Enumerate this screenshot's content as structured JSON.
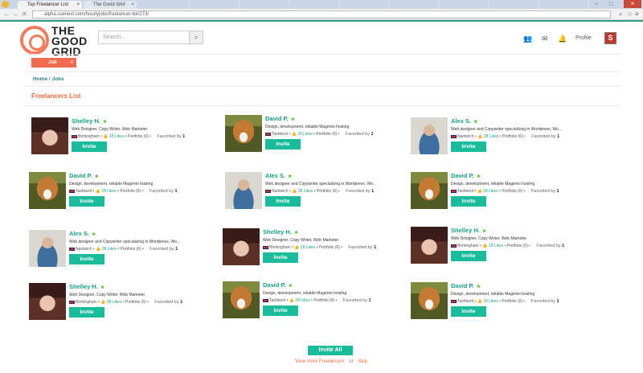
{
  "browser": {
    "active_tab_title": "Top Freelancer List",
    "second_tab_title": "The Good Grid",
    "url": "alpha.csenext.com/hourlyjobs/freelancer-list/273/"
  },
  "header": {
    "logo_text_top": "THE GOOD",
    "logo_text_bottom": "GRID",
    "search_placeholder": "Search...",
    "profile_label": "Profile",
    "avatar_letter": "S"
  },
  "nav": {
    "job_button": "Job",
    "breadcrumb": "Home / Jobs"
  },
  "section_title": "Freelancers List",
  "cards": [
    {
      "name": "Shelley H.",
      "title": "Web Designer, Copy Writer, Web Marketer",
      "location": "Birmingham",
      "likes": "28 Likes",
      "portfolio": "Portfolio (6)",
      "favorited_prefix": "Favorited by",
      "favorited_count": "1",
      "invite": "Invite",
      "photo": "woman"
    },
    {
      "name": "David P.",
      "title": "Design, development, reliable Magento hosting",
      "location": "Tashkent",
      "likes": "28 Likes",
      "portfolio": "Portfolio (6)",
      "favorited_prefix": "Favorited by",
      "favorited_count": "1",
      "invite": "Invite",
      "photo": "dog"
    },
    {
      "name": "Alex S.",
      "title": "Web designer and Copywriter specializing in Wordpress, Wo...",
      "location": "Nantwich",
      "likes": "28 Likes",
      "portfolio": "Portfolio (6)",
      "favorited_prefix": "Favorited by",
      "favorited_count": "1",
      "invite": "Invite",
      "photo": "man"
    },
    {
      "name": "David P.",
      "title": "Design, development, reliable Magento hosting",
      "location": "Tashkent",
      "likes": "28 Likes",
      "portfolio": "Portfolio (6)",
      "favorited_prefix": "Favorited by",
      "favorited_count": "1",
      "invite": "Invite",
      "photo": "dog"
    },
    {
      "name": "Alex S.",
      "title": "Web designer and Copywriter specializing in Wordpress, Wo...",
      "location": "Nantwich",
      "likes": "28 Likes",
      "portfolio": "Portfolio (6)",
      "favorited_prefix": "Favorited by",
      "favorited_count": "1",
      "invite": "Invite",
      "photo": "man"
    },
    {
      "name": "David P.",
      "title": "Design, development, reliable Magento hosting",
      "location": "Tashkent",
      "likes": "28 Likes",
      "portfolio": "Portfolio (6)",
      "favorited_prefix": "Favorited by",
      "favorited_count": "1",
      "invite": "Invite",
      "photo": "dog"
    },
    {
      "name": "Alex S.",
      "title": "Web designer and Copywriter specializing in Wordpress, Wo...",
      "location": "Nantwich",
      "likes": "28 Likes",
      "portfolio": "Portfolio (6)",
      "favorited_prefix": "Favorited by",
      "favorited_count": "1",
      "invite": "Invite",
      "photo": "man"
    },
    {
      "name": "Shelley H.",
      "title": "Web Designer, Copy Writer, Web Marketer",
      "location": "Birmingham",
      "likes": "28 Likes",
      "portfolio": "Portfolio (6)",
      "favorited_prefix": "Favorited by",
      "favorited_count": "1",
      "invite": "Invite",
      "photo": "woman"
    },
    {
      "name": "Shelley H.",
      "title": "Web Designer, Copy Writer, Web Marketer",
      "location": "Birmingham",
      "likes": "28 Likes",
      "portfolio": "Portfolio (6)",
      "favorited_prefix": "Favorited by",
      "favorited_count": "1",
      "invite": "Invite",
      "photo": "woman"
    },
    {
      "name": "Shelley H.",
      "title": "Web Designer, Copy Writer, Web Marketer",
      "location": "Birmingham",
      "likes": "28 Likes",
      "portfolio": "Portfolio (6)",
      "favorited_prefix": "Favorited by",
      "favorited_count": "1",
      "invite": "Invite",
      "photo": "woman"
    },
    {
      "name": "David P.",
      "title": "Design, development, reliable Magento hosting",
      "location": "Tashkent",
      "likes": "28 Likes",
      "portfolio": "Portfolio (6)",
      "favorited_prefix": "Favorited by",
      "favorited_count": "1",
      "invite": "Invite",
      "photo": "dog"
    },
    {
      "name": "David P.",
      "title": "Design, development, reliable Magento hosting",
      "location": "Tashkent",
      "likes": "28 Likes",
      "portfolio": "Portfolio (6)",
      "favorited_prefix": "Favorited by",
      "favorited_count": "1",
      "invite": "Invite",
      "photo": "dog"
    }
  ],
  "footer": {
    "invite_all": "Invite  All",
    "view_more": "View more Freelancers",
    "or": "or",
    "skip": "Skip"
  },
  "colors": {
    "accent": "#1abc9c",
    "brand_orange": "#ef6a3a",
    "name_green": "#16a085"
  }
}
